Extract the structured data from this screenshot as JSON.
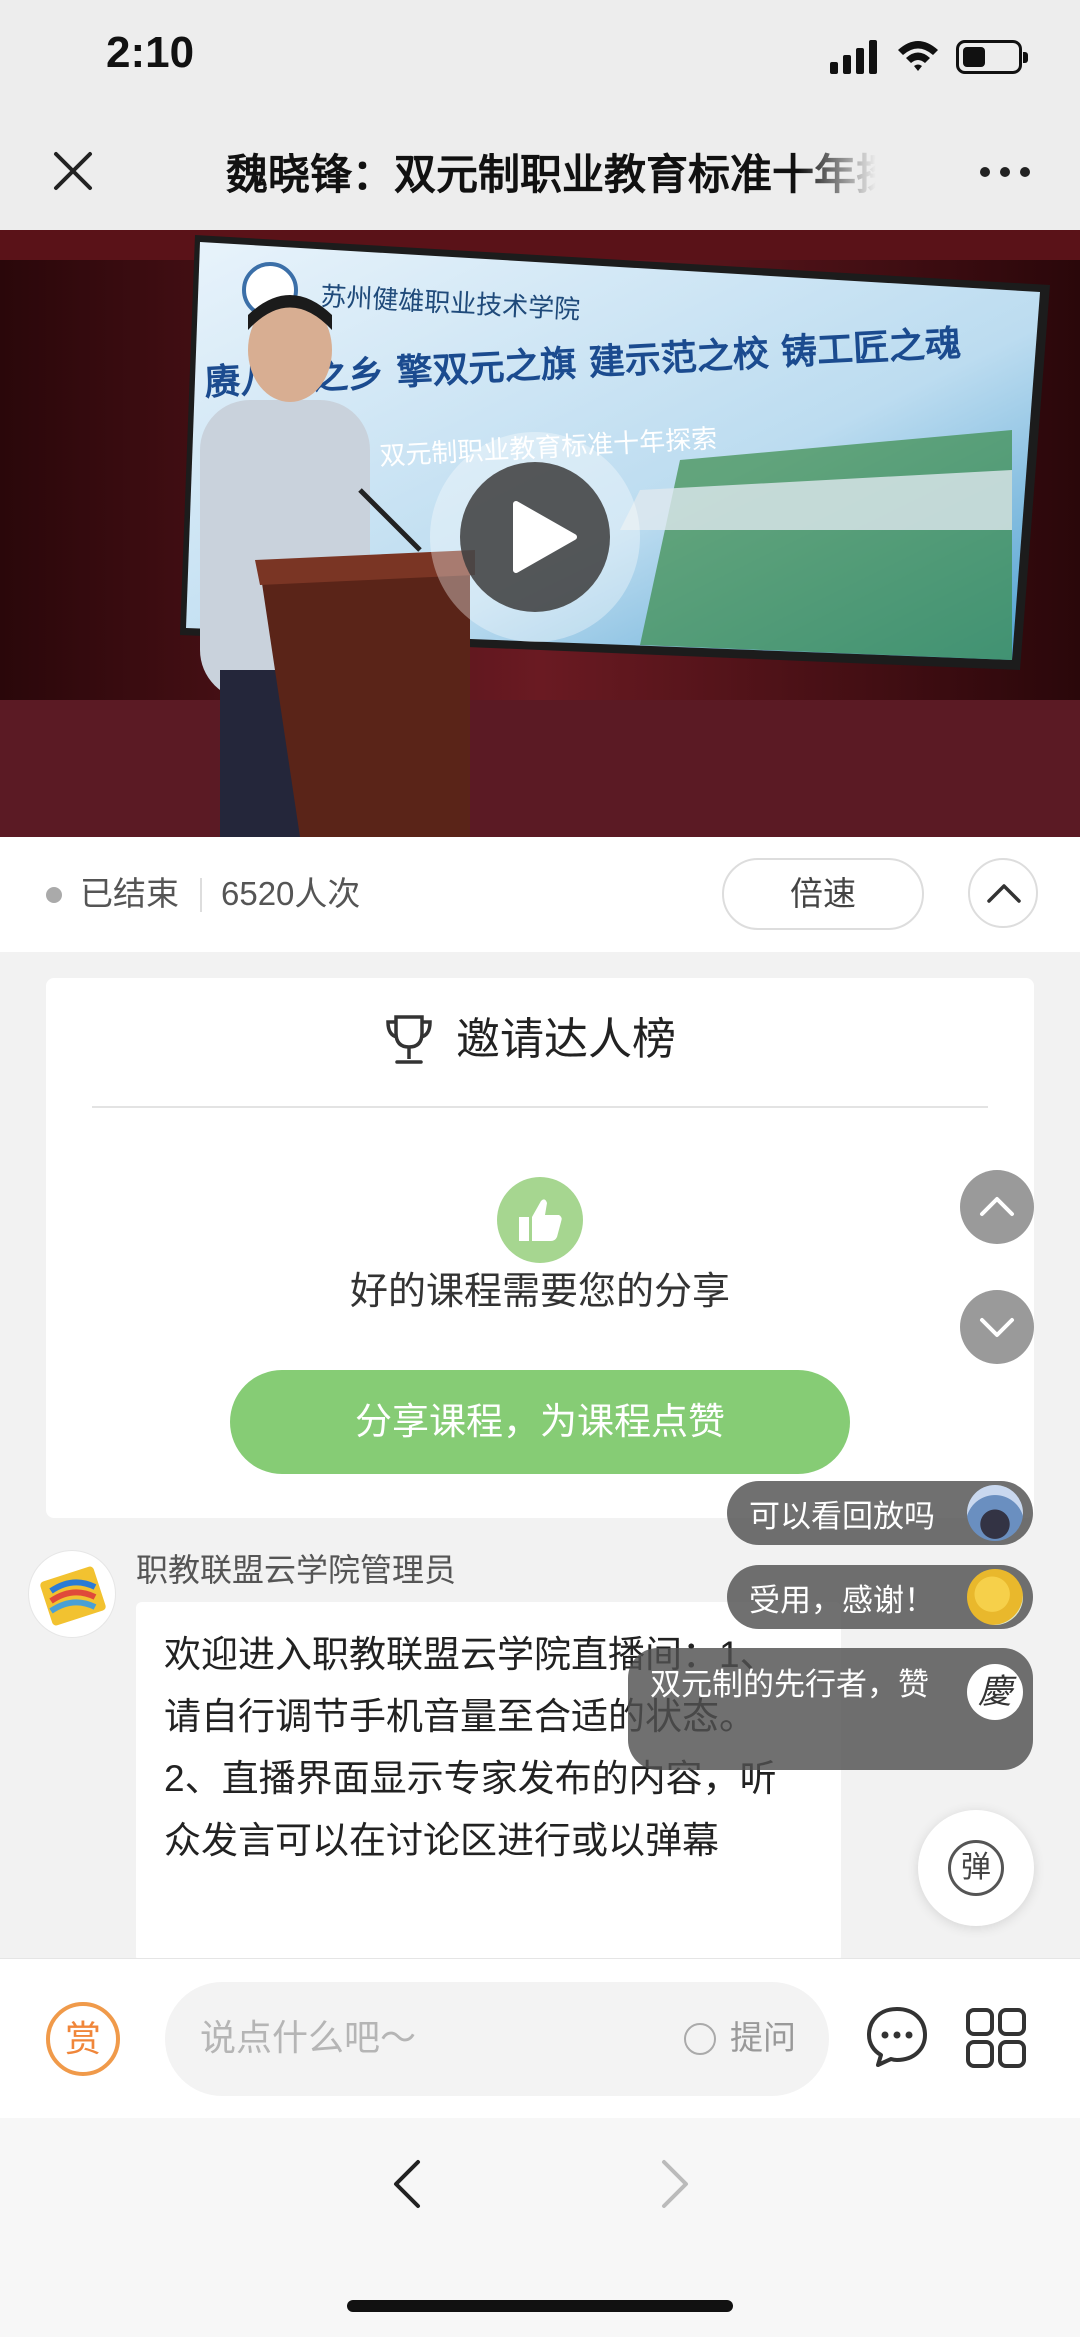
{
  "status_bar": {
    "time": "2:10"
  },
  "nav": {
    "title": "魏晓锋：双元制职业教育标准十年探索"
  },
  "video": {
    "slide_school": "苏州健雄职业技术学院",
    "slide_slogan": "赓八今之乡 擎双元之旗 建示范之校 铸工匠之魂",
    "slide_subtitle": "双元制职业教育标准十年探索"
  },
  "info": {
    "status": "已结束",
    "viewers": "6520人次",
    "speed_label": "倍速"
  },
  "invite_card": {
    "title": "邀请达人榜",
    "prompt": "好的课程需要您的分享",
    "button": "分享课程，为课程点赞"
  },
  "message": {
    "sender": "职教联盟云学院管理员",
    "text": "欢迎进入职教联盟云学院直播间：1、请自行调节手机音量至合适的状态。2、直播界面显示专家发布的内容，听众发言可以在讨论区进行或以弹幕"
  },
  "danmaku": [
    {
      "text": "可以看回放吗"
    },
    {
      "text": "受用，感谢！"
    },
    {
      "text": "双元制的先行者，赞",
      "avatar_char": "慶"
    }
  ],
  "danmu_toggle_label": "弹",
  "input_bar": {
    "reward_label": "赏",
    "placeholder": "说点什么吧～",
    "question_label": "提问"
  },
  "colors": {
    "accent_green": "#86cc75",
    "reward_orange": "#f0863a"
  }
}
